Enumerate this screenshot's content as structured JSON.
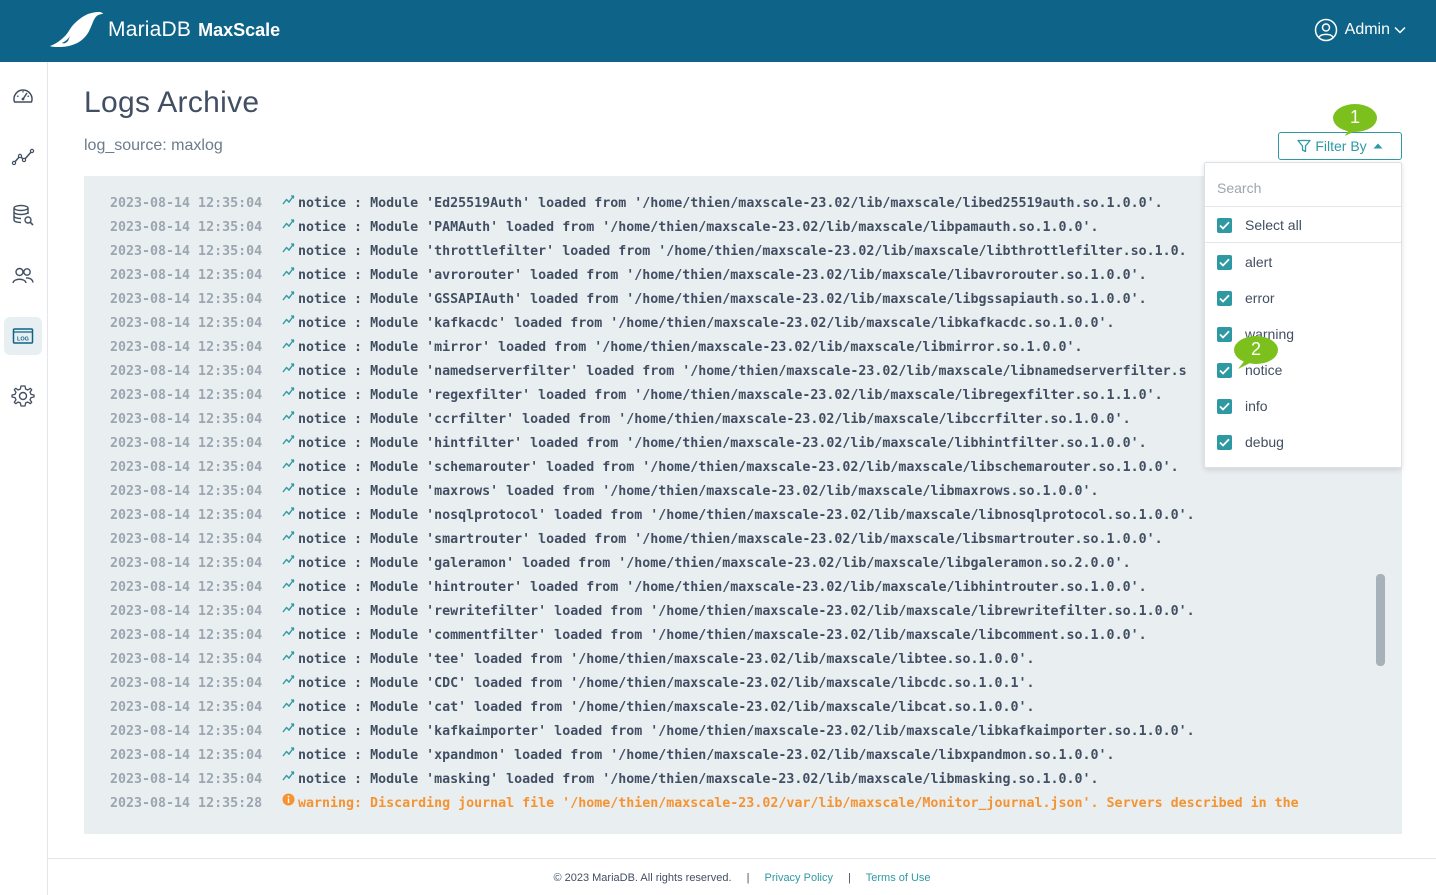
{
  "header": {
    "brand": "MariaDB",
    "product": "MaxScale",
    "user_name": "Admin"
  },
  "sidebar": {
    "items": [
      {
        "name": "dashboard",
        "icon": "speedometer-icon"
      },
      {
        "name": "visualization",
        "icon": "line-graph-icon"
      },
      {
        "name": "query-editor",
        "icon": "database-search-icon"
      },
      {
        "name": "users",
        "icon": "users-icon"
      },
      {
        "name": "logs-archive",
        "icon": "logs-icon",
        "active": true,
        "icon_text": "LOG"
      },
      {
        "name": "settings",
        "icon": "gear-icon"
      }
    ]
  },
  "page": {
    "title": "Logs Archive",
    "subtitle": "log_source: maxlog"
  },
  "filter": {
    "button_label": "Filter By",
    "search_placeholder": "Search",
    "select_all_label": "Select all",
    "options": [
      {
        "label": "alert",
        "checked": true
      },
      {
        "label": "error",
        "checked": true
      },
      {
        "label": "warning",
        "checked": true
      },
      {
        "label": "notice",
        "checked": true
      },
      {
        "label": "info",
        "checked": true
      },
      {
        "label": "debug",
        "checked": true
      }
    ]
  },
  "annotations": {
    "callout_1": "1",
    "callout_2": "2"
  },
  "logs": [
    {
      "ts": "2023-08-14 12:35:04",
      "level": "notice",
      "msg": " : Module 'Ed25519Auth' loaded from '/home/thien/maxscale-23.02/lib/maxscale/libed25519auth.so.1.0.0'."
    },
    {
      "ts": "2023-08-14 12:35:04",
      "level": "notice",
      "msg": " : Module 'PAMAuth' loaded from '/home/thien/maxscale-23.02/lib/maxscale/libpamauth.so.1.0.0'."
    },
    {
      "ts": "2023-08-14 12:35:04",
      "level": "notice",
      "msg": " : Module 'throttlefilter' loaded from '/home/thien/maxscale-23.02/lib/maxscale/libthrottlefilter.so.1.0."
    },
    {
      "ts": "2023-08-14 12:35:04",
      "level": "notice",
      "msg": " : Module 'avrorouter' loaded from '/home/thien/maxscale-23.02/lib/maxscale/libavrorouter.so.1.0.0'."
    },
    {
      "ts": "2023-08-14 12:35:04",
      "level": "notice",
      "msg": " : Module 'GSSAPIAuth' loaded from '/home/thien/maxscale-23.02/lib/maxscale/libgssapiauth.so.1.0.0'."
    },
    {
      "ts": "2023-08-14 12:35:04",
      "level": "notice",
      "msg": " : Module 'kafkacdc' loaded from '/home/thien/maxscale-23.02/lib/maxscale/libkafkacdc.so.1.0.0'."
    },
    {
      "ts": "2023-08-14 12:35:04",
      "level": "notice",
      "msg": " : Module 'mirror' loaded from '/home/thien/maxscale-23.02/lib/maxscale/libmirror.so.1.0.0'."
    },
    {
      "ts": "2023-08-14 12:35:04",
      "level": "notice",
      "msg": " : Module 'namedserverfilter' loaded from '/home/thien/maxscale-23.02/lib/maxscale/libnamedserverfilter.s"
    },
    {
      "ts": "2023-08-14 12:35:04",
      "level": "notice",
      "msg": " : Module 'regexfilter' loaded from '/home/thien/maxscale-23.02/lib/maxscale/libregexfilter.so.1.1.0'."
    },
    {
      "ts": "2023-08-14 12:35:04",
      "level": "notice",
      "msg": " : Module 'ccrfilter' loaded from '/home/thien/maxscale-23.02/lib/maxscale/libccrfilter.so.1.0.0'."
    },
    {
      "ts": "2023-08-14 12:35:04",
      "level": "notice",
      "msg": " : Module 'hintfilter' loaded from '/home/thien/maxscale-23.02/lib/maxscale/libhintfilter.so.1.0.0'."
    },
    {
      "ts": "2023-08-14 12:35:04",
      "level": "notice",
      "msg": " : Module 'schemarouter' loaded from '/home/thien/maxscale-23.02/lib/maxscale/libschemarouter.so.1.0.0'."
    },
    {
      "ts": "2023-08-14 12:35:04",
      "level": "notice",
      "msg": " : Module 'maxrows' loaded from '/home/thien/maxscale-23.02/lib/maxscale/libmaxrows.so.1.0.0'."
    },
    {
      "ts": "2023-08-14 12:35:04",
      "level": "notice",
      "msg": " : Module 'nosqlprotocol' loaded from '/home/thien/maxscale-23.02/lib/maxscale/libnosqlprotocol.so.1.0.0'."
    },
    {
      "ts": "2023-08-14 12:35:04",
      "level": "notice",
      "msg": " : Module 'smartrouter' loaded from '/home/thien/maxscale-23.02/lib/maxscale/libsmartrouter.so.1.0.0'."
    },
    {
      "ts": "2023-08-14 12:35:04",
      "level": "notice",
      "msg": " : Module 'galeramon' loaded from '/home/thien/maxscale-23.02/lib/maxscale/libgaleramon.so.2.0.0'."
    },
    {
      "ts": "2023-08-14 12:35:04",
      "level": "notice",
      "msg": " : Module 'hintrouter' loaded from '/home/thien/maxscale-23.02/lib/maxscale/libhintrouter.so.1.0.0'."
    },
    {
      "ts": "2023-08-14 12:35:04",
      "level": "notice",
      "msg": " : Module 'rewritefilter' loaded from '/home/thien/maxscale-23.02/lib/maxscale/librewritefilter.so.1.0.0'."
    },
    {
      "ts": "2023-08-14 12:35:04",
      "level": "notice",
      "msg": " : Module 'commentfilter' loaded from '/home/thien/maxscale-23.02/lib/maxscale/libcomment.so.1.0.0'."
    },
    {
      "ts": "2023-08-14 12:35:04",
      "level": "notice",
      "msg": " : Module 'tee' loaded from '/home/thien/maxscale-23.02/lib/maxscale/libtee.so.1.0.0'."
    },
    {
      "ts": "2023-08-14 12:35:04",
      "level": "notice",
      "msg": " : Module 'CDC' loaded from '/home/thien/maxscale-23.02/lib/maxscale/libcdc.so.1.0.1'."
    },
    {
      "ts": "2023-08-14 12:35:04",
      "level": "notice",
      "msg": " : Module 'cat' loaded from '/home/thien/maxscale-23.02/lib/maxscale/libcat.so.1.0.0'."
    },
    {
      "ts": "2023-08-14 12:35:04",
      "level": "notice",
      "msg": " : Module 'kafkaimporter' loaded from '/home/thien/maxscale-23.02/lib/maxscale/libkafkaimporter.so.1.0.0'."
    },
    {
      "ts": "2023-08-14 12:35:04",
      "level": "notice",
      "msg": " : Module 'xpandmon' loaded from '/home/thien/maxscale-23.02/lib/maxscale/libxpandmon.so.1.0.0'."
    },
    {
      "ts": "2023-08-14 12:35:04",
      "level": "notice",
      "msg": " : Module 'masking' loaded from '/home/thien/maxscale-23.02/lib/maxscale/libmasking.so.1.0.0'."
    },
    {
      "ts": "2023-08-14 12:35:28",
      "level": "warning",
      "msg": ": Discarding journal file '/home/thien/maxscale-23.02/var/lib/maxscale/Monitor_journal.json'. Servers described in the"
    }
  ],
  "footer": {
    "copyright": "© 2023 MariaDB. All rights reserved.",
    "divider": "|",
    "privacy": "Privacy Policy",
    "terms": "Terms of Use"
  },
  "colors": {
    "header_bg": "#0e6488",
    "accent": "#2f99a3",
    "warning": "#f59331",
    "callout": "#7cc01e",
    "log_bg": "#e9eef1"
  }
}
